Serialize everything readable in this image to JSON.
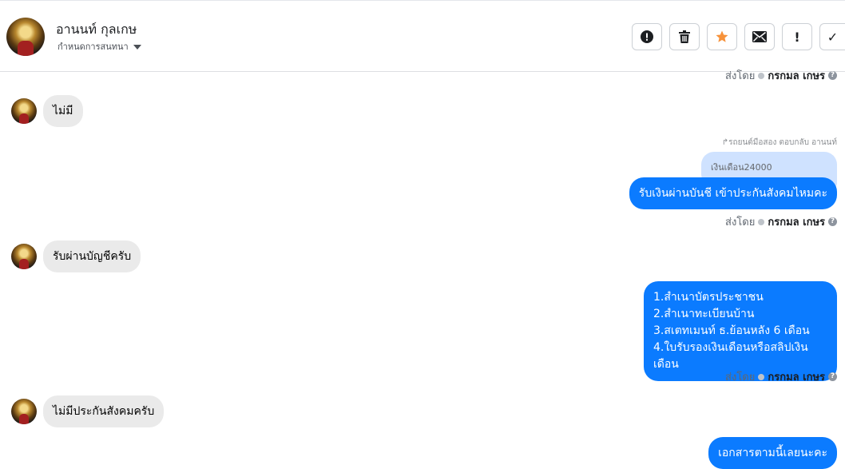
{
  "header": {
    "contact_name": "อานนท์ กุลเกษ",
    "subtitle": "กำหนดการสนทนา",
    "actions": [
      {
        "icon": "alert-circle-icon"
      },
      {
        "icon": "trash-icon"
      },
      {
        "icon": "star-icon"
      },
      {
        "icon": "mail-icon"
      },
      {
        "icon": "exclamation-icon",
        "glyph": "!"
      },
      {
        "icon": "check-icon",
        "glyph": "✓"
      }
    ]
  },
  "meta_top": {
    "prefix": "ส่งโดย",
    "name": "กรกมล เกษร"
  },
  "messages": {
    "m1": "ไม่มี",
    "reply_note": "↱รถยนต์มือสอง ตอบกลับ อานนท์",
    "quoted": "เงินเดือน24000",
    "m2": "รับเงินผ่านบันชี เข้าประกันสังคมไหมคะ",
    "meta2": {
      "prefix": "ส่งโดย",
      "name": "กรกมล เกษร"
    },
    "m3": "รับผ่านบัญชีครับ",
    "m4_lines": [
      "1.สำเนาบัตรประชาชน",
      "2.สำเนาทะเบียนบ้าน",
      "3.สเตทเมนท์ ธ.ย้อนหลัง 6 เดือน",
      "4.ใบรับรองเงินเดือนหรือสลิปเงินเดือน"
    ],
    "meta4": {
      "prefix": "ส่งโดย",
      "name": "กรกมล เกษร"
    },
    "m5": "ไม่มีประกันสังคมครับ",
    "m6": "เอกสารตามนี้เลยนะคะ"
  },
  "colors": {
    "outgoing": "#0b7bff",
    "incoming": "#eaeaea",
    "star": "#f7923a"
  }
}
